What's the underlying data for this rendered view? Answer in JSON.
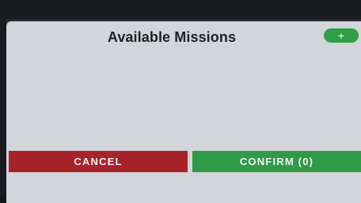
{
  "dialog": {
    "title": "Available Missions",
    "add_label": "+",
    "cancel_label": "CANCEL",
    "confirm_label": "CONFIRM (0)"
  },
  "colors": {
    "panel": "#d3d5da",
    "cancel": "#a8222a",
    "confirm": "#2f9a47",
    "add": "#2ea043"
  }
}
